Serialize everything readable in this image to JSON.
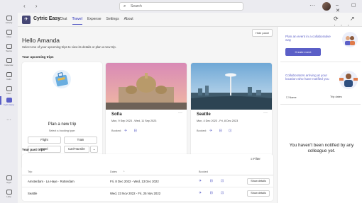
{
  "topbar": {
    "search_placeholder": "Search"
  },
  "rail": [
    {
      "label": "Activity"
    },
    {
      "label": "Chat"
    },
    {
      "label": "Teams"
    },
    {
      "label": "Calendar"
    },
    {
      "label": "Calls"
    },
    {
      "label": "Files"
    },
    {
      "label": "Cytric Easy"
    }
  ],
  "rail_bottom": [
    {
      "label": "Apps"
    },
    {
      "label": "Help"
    }
  ],
  "app": {
    "name": "Cytric Easy",
    "tabs": [
      {
        "label": "Chat"
      },
      {
        "label": "Travel"
      },
      {
        "label": "Expense"
      },
      {
        "label": "Settings"
      },
      {
        "label": "About"
      }
    ],
    "active_tab": "Travel"
  },
  "main": {
    "hide_panel": "Hide panel",
    "greeting": "Hello Amanda",
    "subtitle": "Select one of your upcoming trips to view its details or plan a new trip.",
    "upcoming_title": "Your upcoming trips",
    "past_title": "Your past trips"
  },
  "plan": {
    "title": "Plan a new trip",
    "subtitle": "Select a booking type:",
    "buttons": [
      "Flight",
      "Train",
      "Hotel",
      "Car/Transfer"
    ],
    "link": "Go to Cytric web"
  },
  "trips": [
    {
      "city": "Sofia",
      "dates": "Mon, 9 Sep 2023 - Wed, 11 Sep 2023",
      "booked": "Booked:"
    },
    {
      "city": "Seattle",
      "dates": "Mon, 4 Dec 2023 - Fri, 8 Dec 2023",
      "booked": "Booked:"
    }
  ],
  "past": {
    "filter": "Filter",
    "headers": {
      "trip": "Trip",
      "dates": "Dates",
      "booked": "Booked"
    },
    "rows": [
      {
        "trip": "Amsterdam · La Haye · Rotterdam",
        "dates": "Fri, 8 Dec 2022 - Wed, 13 Dec 2022",
        "action": "Show details"
      },
      {
        "trip": "Seattle",
        "dates": "Wed, 23 Nov 2022 - Fri, 25 Nov 2022",
        "action": "Show details"
      }
    ]
  },
  "side": {
    "event_title": "Plan an event in a collaborative way",
    "event_button": "Create event",
    "colleagues_title": "Collaborators arriving at your location who have notified you",
    "col_name": "Name",
    "col_trip": "Trip dates",
    "empty_text": "You haven't been notified by any colleague yet."
  },
  "colors": {
    "accent": "#5b5fc7",
    "logo": "#464775"
  }
}
